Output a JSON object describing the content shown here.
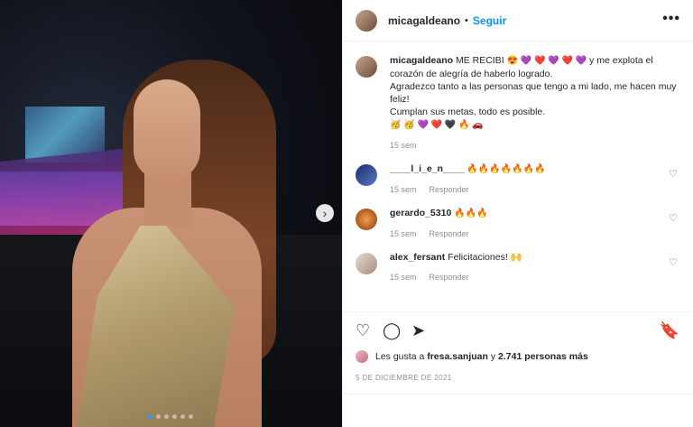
{
  "post": {
    "username": "micagaldeano",
    "separator": "•",
    "follow_label": "Seguir",
    "more_label": "•••",
    "caption": {
      "username": "micagaldeano",
      "line1": "ME RECIBI",
      "line1_tail": "y me explota el corazón de alegría de haberlo logrado.",
      "line2": "Agradezco tanto a las personas que tengo a mi lado, me hacen muy feliz!",
      "line3": "Cumplan sus metas, todo es posible.",
      "emojis1": "😍 💜 ❤️ 💜 ❤️ 💜",
      "emojis2": "🥳 🥳 💜 ❤️ 🖤 🔥 🚗",
      "time": "15 sem"
    }
  },
  "comments": [
    {
      "username": "____l_i_e_n____",
      "text": "🔥🔥🔥🔥🔥🔥🔥",
      "time": "15 sem",
      "reply": "Responder"
    },
    {
      "username": "gerardo_5310",
      "text": "🔥🔥🔥",
      "time": "15 sem",
      "reply": "Responder"
    },
    {
      "username": "alex_fersant",
      "text": "Felicitaciones! 🙌",
      "time": "15 sem",
      "reply": "Responder"
    }
  ],
  "likes": {
    "prefix": "Les gusta a",
    "user": "fresa.sanjuan",
    "connector": "y",
    "count": "2.741 personas más"
  },
  "date": "5 DE DICIEMBRE DE 2021",
  "carousel": {
    "total": 6,
    "active_index": 0
  }
}
